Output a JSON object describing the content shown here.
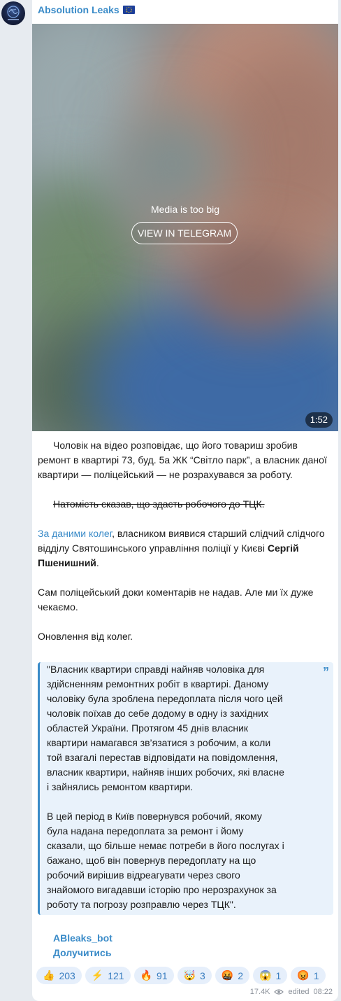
{
  "channel": {
    "name": "Absolution Leaks",
    "flag_icon": "eu-flag-icon",
    "accent": "#3a8bc8"
  },
  "media": {
    "notice": "Media is too big",
    "button": "VIEW IN TELEGRAM",
    "duration": "1:52"
  },
  "post": {
    "p1": "Чоловік на відео розповідає, що його товариш зробив ремонт в квартирі 73, буд. 5а ЖК “Світло парк”, а власник даної квартири — поліцейський — не розрахувався за роботу.",
    "p2_strike": "Натомість сказав, що здасть робочого до ТЦК.",
    "p3_link": "За даними колег",
    "p3_text": ", власником виявися старший слідчий слідчого відділу Святошинського управління поліції у Києві ",
    "p3_name": "Сергій Пшенишний",
    "p3_end": ".",
    "p4": "Сам поліцейський доки коментарів не надав. Але ми їх дуже чекаємо.",
    "p5": "Оновлення від колег.",
    "quote_p1": "\"Власник квартири справді найняв чоловіка для здійсненням ремонтних робіт в квартирі. Даному чоловіку була зроблена передоплата після чого цей чоловік поїхав до себе додому в одну із західних областей України. Протягом 45 днів власник квартири намагався зв’язатися з робочим, а коли той взагалі перестав відповідати на повідомлення, власник квартири, найняв інших робочих, які власне і зайнялись ремонтом квартири.",
    "quote_p2": "В цей період в Київ повернувся робочий, якому була надана передоплата за ремонт і йому сказали, що більше немає потреби в його послугах і бажано, щоб він повернув передоплату на що робочий вирішив відреагувати через свого знайомого вигадавши історію про нерозрахунок за роботу та погрозу розправлю через ТЦК\".",
    "quote_icon": "quote-icon",
    "sig_bot": "ABleaks_bot",
    "sig_join": "Долучитись"
  },
  "reactions": [
    {
      "emoji": "👍",
      "count": "203"
    },
    {
      "emoji": "⚡",
      "count": "121"
    },
    {
      "emoji": "🔥",
      "count": "91"
    },
    {
      "emoji": "🤯",
      "count": "3"
    },
    {
      "emoji": "🤬",
      "count": "2"
    },
    {
      "emoji": "😱",
      "count": "1"
    },
    {
      "emoji": "😡",
      "count": "1"
    }
  ],
  "meta": {
    "views": "17.4K",
    "views_icon": "eye-icon",
    "edited": "edited",
    "time": "08:22"
  }
}
